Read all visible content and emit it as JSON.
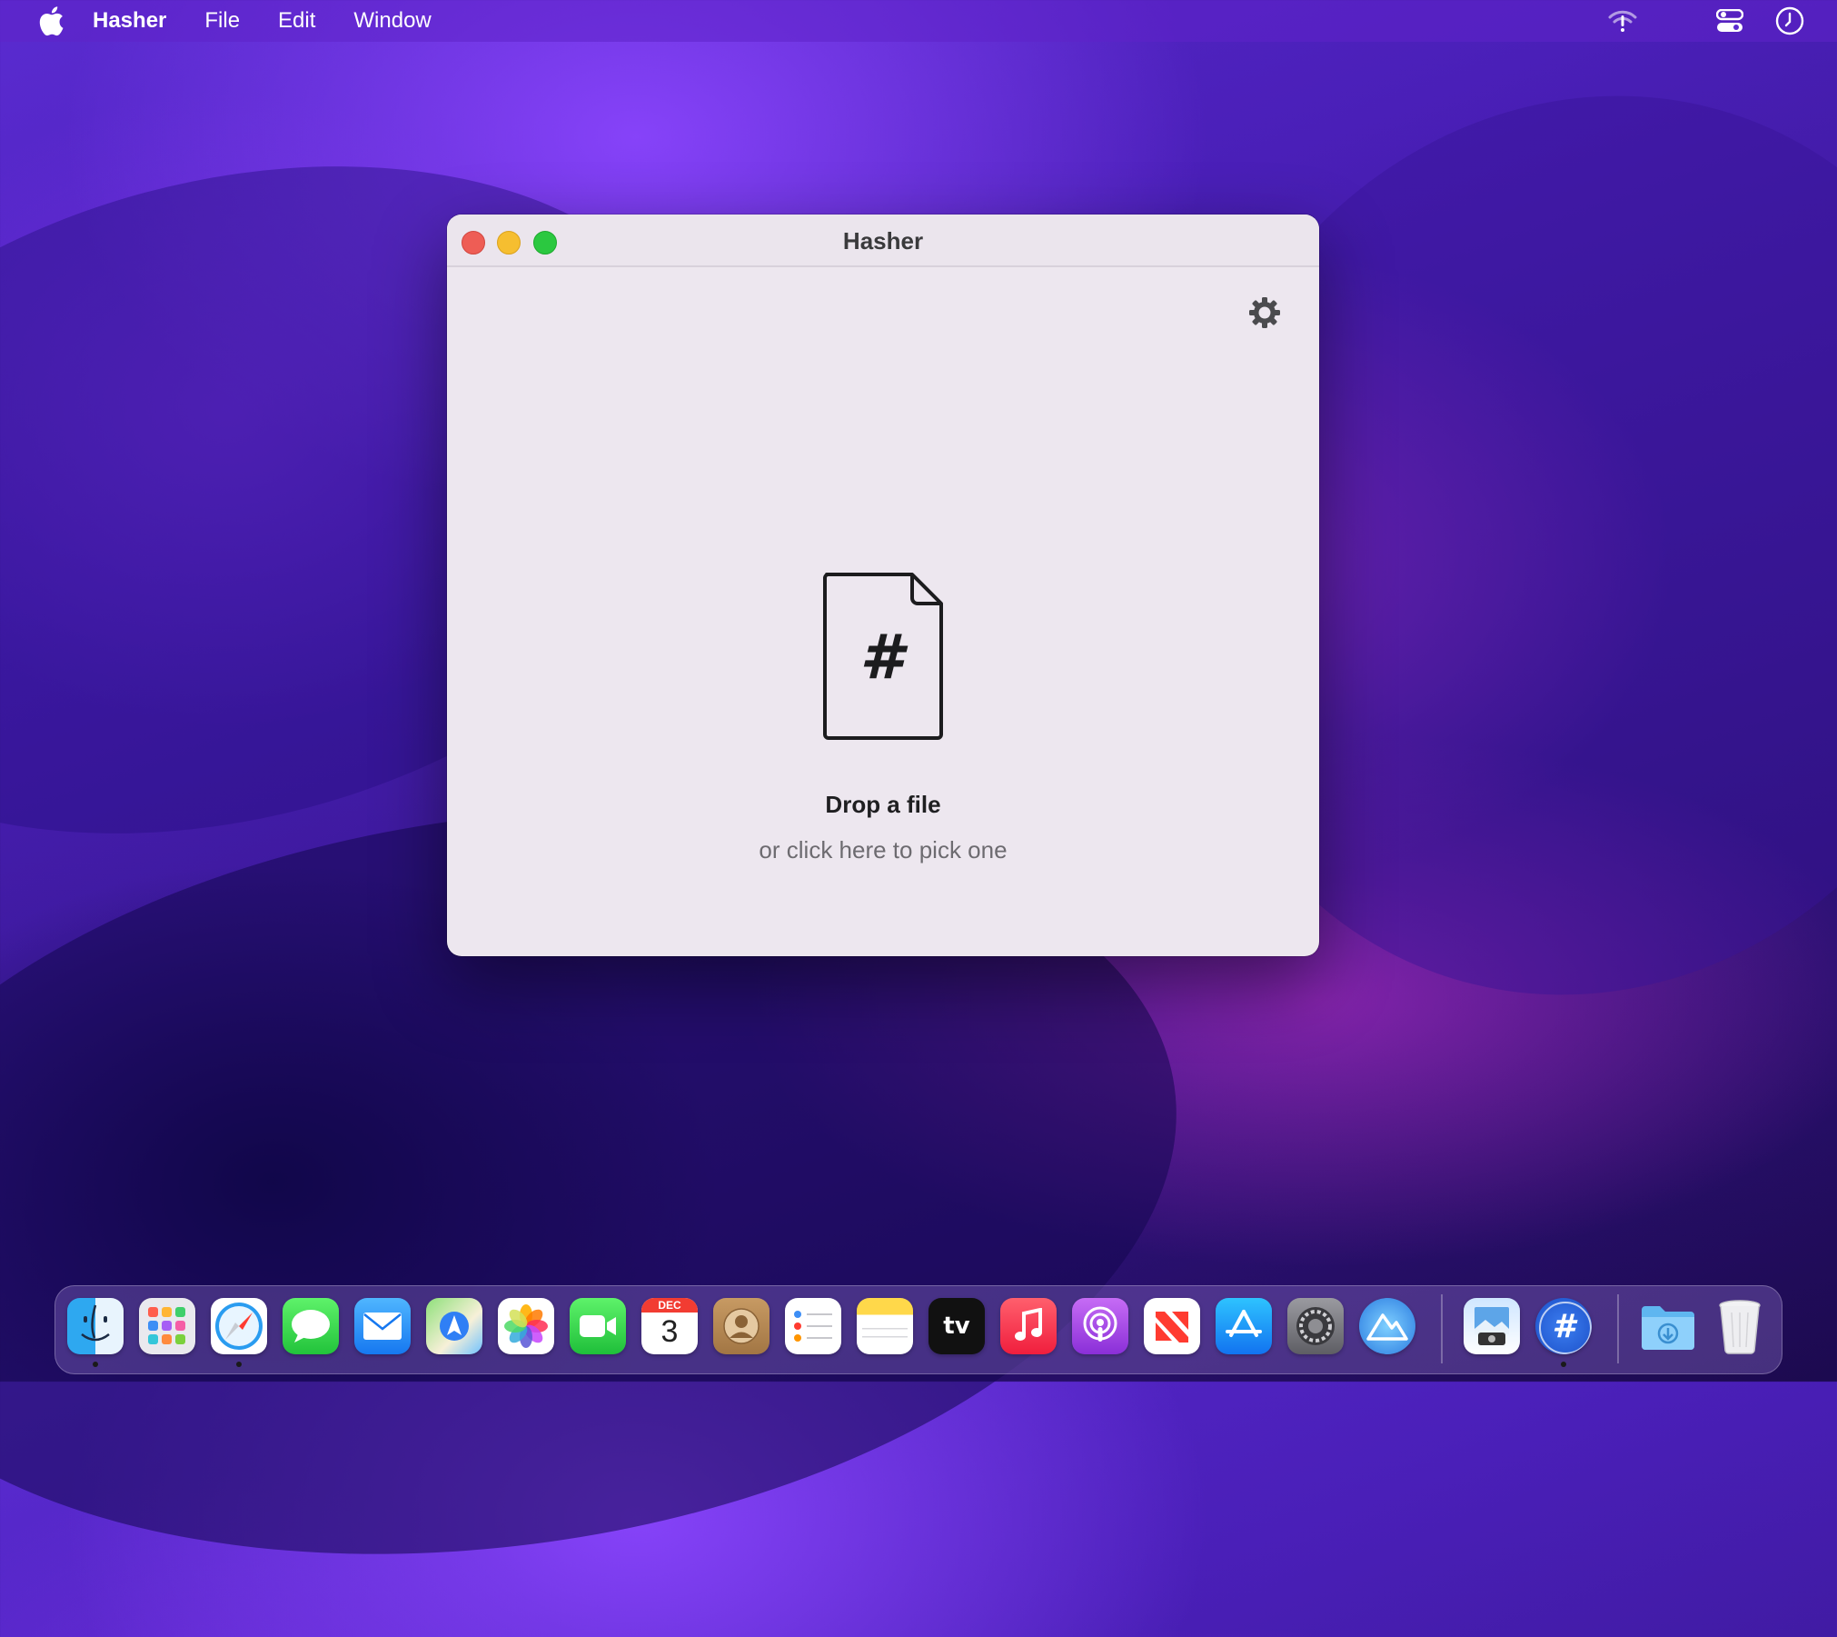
{
  "menubar": {
    "app_name": "Hasher",
    "items": [
      "File",
      "Edit",
      "Window"
    ]
  },
  "window": {
    "title": "Hasher",
    "drop_title": "Drop a file",
    "drop_subtitle": "or click here to pick one",
    "doc_glyph": "#"
  },
  "dock": {
    "calendar_month": "DEC",
    "calendar_day": "3",
    "tv_label": "tv",
    "hasher_glyph": "#",
    "apps": [
      "Finder",
      "Launchpad",
      "Safari",
      "Messages",
      "Mail",
      "Maps",
      "Photos",
      "FaceTime",
      "Calendar",
      "Contacts",
      "Reminders",
      "Notes",
      "TV",
      "Music",
      "Podcasts",
      "News",
      "App Store",
      "System Preferences",
      "Xcloud",
      "Preview",
      "Hasher",
      "Downloads",
      "Trash"
    ]
  },
  "colors": {
    "close": "#ee5d55",
    "minimize": "#f6be30",
    "maximize": "#2bc840",
    "window_bg": "#ede7ef"
  }
}
